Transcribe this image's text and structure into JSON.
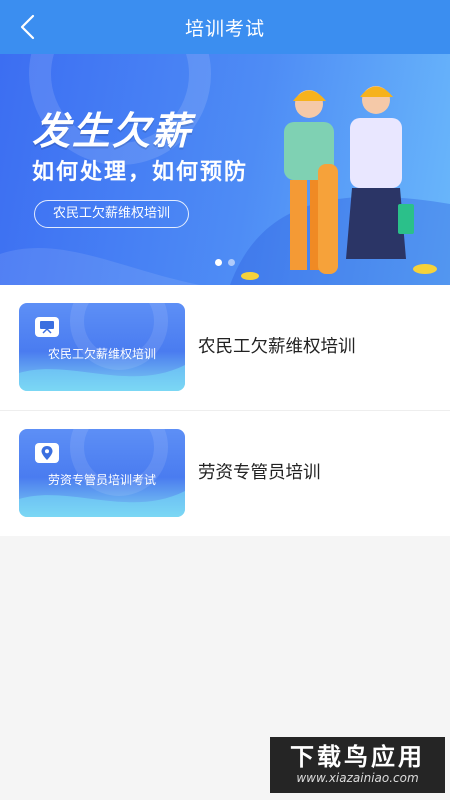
{
  "header": {
    "title": "培训考试",
    "back_icon": "chevron-left-icon"
  },
  "banner": {
    "headline": "发生欠薪",
    "subline": "如何处理，如何预防",
    "pill": "农民工欠薪维权培训",
    "slides": 2,
    "active_slide": 1
  },
  "courses": [
    {
      "thumb_label": "农民工欠薪维权培训",
      "title": "农民工欠薪维权培训",
      "icon": "presentation-board-icon"
    },
    {
      "thumb_label": "劳资专管员培训考试",
      "title": "劳资专管员培训",
      "icon": "location-pin-icon"
    }
  ],
  "watermark": {
    "main": "下载鸟应用",
    "sub": "www.xiazainiao.com"
  },
  "colors": {
    "primary": "#3b8ef0",
    "banner_start": "#3c6ef2",
    "banner_end": "#6ab8fb"
  }
}
